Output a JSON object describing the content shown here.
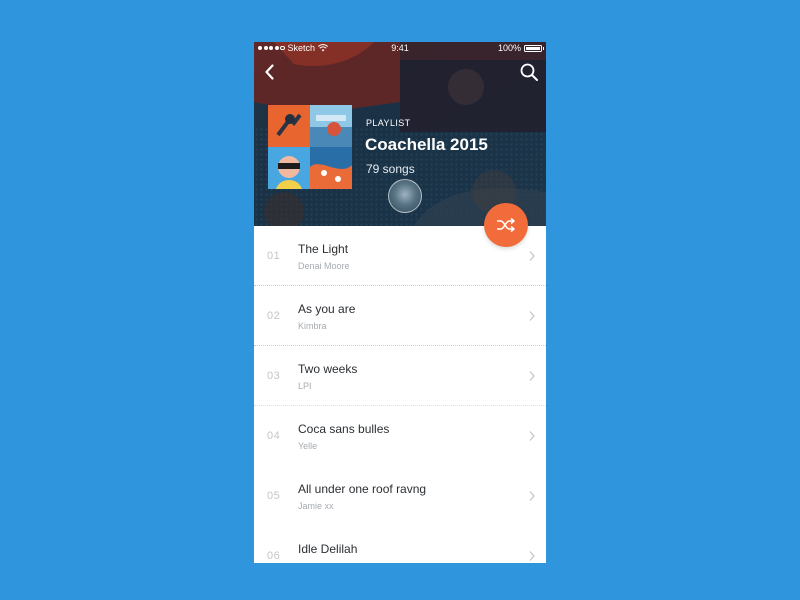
{
  "status_bar": {
    "carrier": "Sketch",
    "time": "9:41",
    "battery": "100%"
  },
  "header": {
    "eyebrow": "PLAYLIST",
    "title": "Coachella 2015",
    "song_count": "79 songs",
    "accent_color": "#f26b3a"
  },
  "icons": {
    "back": "back-chevron-icon",
    "search": "search-icon",
    "shuffle": "shuffle-icon",
    "row": "chevron-right-icon"
  },
  "tracks": [
    {
      "num": "01",
      "title": "The Light",
      "artist": "Denai Moore"
    },
    {
      "num": "02",
      "title": "As you are",
      "artist": "Kimbra"
    },
    {
      "num": "03",
      "title": "Two weeks",
      "artist": "LPI"
    },
    {
      "num": "04",
      "title": "Coca sans bulles",
      "artist": "Yelle"
    },
    {
      "num": "05",
      "title": "All under one roof ravng",
      "artist": "Jamie xx"
    },
    {
      "num": "06",
      "title": "Idle Delilah",
      "artist": ""
    }
  ]
}
